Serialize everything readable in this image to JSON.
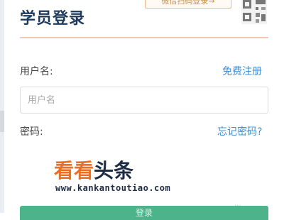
{
  "header": {
    "title": "学员登录",
    "wechat_button": "微信扫码登录→"
  },
  "form": {
    "username_label": "用户名:",
    "register_link": "免费注册",
    "username_placeholder": "用户名",
    "password_label": "密码:",
    "forgot_link": "忘记密码?",
    "login_label": "登录"
  },
  "watermark": {
    "brand_part1": "看看",
    "brand_part2": "头条",
    "url": "www.kankantoutiao.com"
  },
  "corner_logo": "..."
}
